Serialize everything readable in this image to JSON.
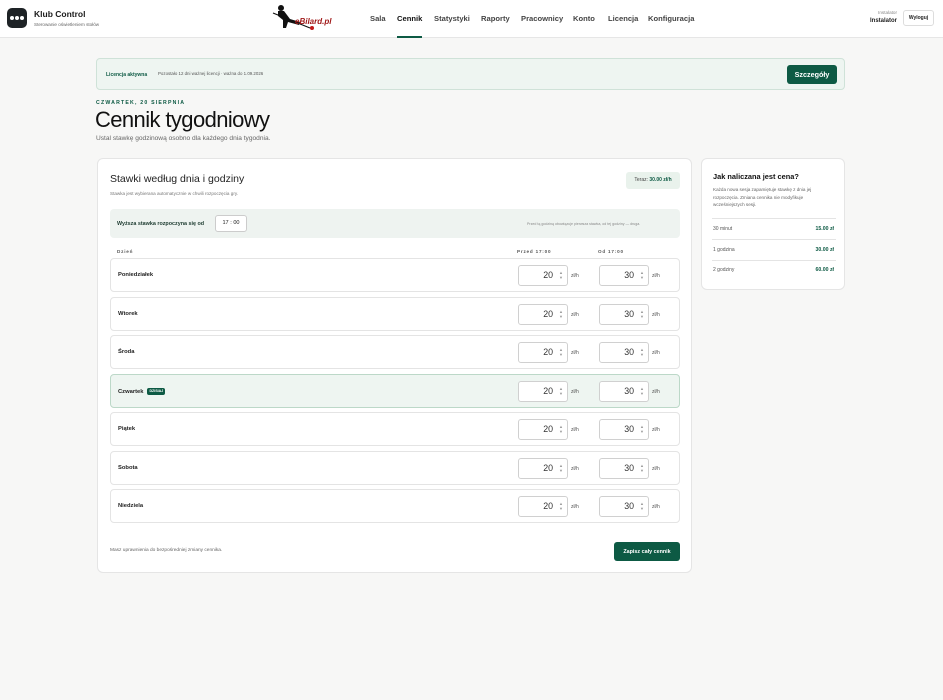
{
  "brand": {
    "title": "Klub Control",
    "subtitle": "Sterowanie oświetleniem stołów"
  },
  "center_logo": {
    "text": "eBilard.pl"
  },
  "nav": [
    {
      "label": "Sala",
      "active": false
    },
    {
      "label": "Cennik",
      "active": true
    },
    {
      "label": "Statystyki",
      "active": false
    },
    {
      "label": "Raporty",
      "active": false
    },
    {
      "label": "Pracownicy",
      "active": false
    },
    {
      "label": "Konto",
      "active": false
    },
    {
      "label": "Licencja",
      "active": false
    },
    {
      "label": "Konfiguracja",
      "active": false
    }
  ],
  "user": {
    "role": "Instalator",
    "name": "Instalator",
    "logout_label": "Wyloguj"
  },
  "license": {
    "status": "Licencja aktywna",
    "info": "Pozostało 12 dni ważnej licencji · ważna do 1.09.2026",
    "details_label": "Szczegóły"
  },
  "header": {
    "date": "Czwartek, 20 sierpnia",
    "title": "Cennik tygodniowy",
    "subtitle": "Ustal stawkę godzinową osobno dla każdego dnia tygodnia."
  },
  "rates": {
    "title": "Stawki według dnia i godziny",
    "subtitle": "Stawka jest wybierana automatycznie w chwili rozpoczęcia gry.",
    "now_label": "Teraz:",
    "now_value": "30.00 zł/h",
    "threshold_label": "Wyższa stawka rozpoczyna się od",
    "threshold_time": "17 : 00",
    "threshold_note": "Przed tą godziną obowiązuje pierwsza stawka, od tej godziny — druga.",
    "col_day": "Dzień",
    "col_before": "Przed 17:00",
    "col_after": "Od 17:00",
    "unit": "zł/h",
    "today_badge": "DZISIAJ",
    "days": [
      {
        "name": "Poniedziałek",
        "before": "20",
        "after": "30",
        "today": false
      },
      {
        "name": "Wtorek",
        "before": "20",
        "after": "30",
        "today": false
      },
      {
        "name": "Środa",
        "before": "20",
        "after": "30",
        "today": false
      },
      {
        "name": "Czwartek",
        "before": "20",
        "after": "30",
        "today": true
      },
      {
        "name": "Piątek",
        "before": "20",
        "after": "30",
        "today": false
      },
      {
        "name": "Sobota",
        "before": "20",
        "after": "30",
        "today": false
      },
      {
        "name": "Niedziela",
        "before": "20",
        "after": "30",
        "today": false
      }
    ],
    "foot_note": "Masz uprawnienia do bezpośredniej zmiany cennika.",
    "save_label": "Zapisz cały cennik"
  },
  "side": {
    "title": "Jak naliczana jest cena?",
    "desc": "Każda nowa sesja zapamiętuje stawkę z dnia jej rozpoczęcia. Zmiana cennika nie modyfikuje wcześniejszych sesji.",
    "items": [
      {
        "label": "30 minut",
        "value": "15.00 zł"
      },
      {
        "label": "1 godzina",
        "value": "30.00 zł"
      },
      {
        "label": "2 godziny",
        "value": "60.00 zł"
      }
    ]
  },
  "colors": {
    "accent": "#0d5a44",
    "accent_light": "#eef5f1"
  },
  "icons": [
    "app-logo-icon",
    "billiard-player-logo",
    "spinner-arrows-icon"
  ]
}
